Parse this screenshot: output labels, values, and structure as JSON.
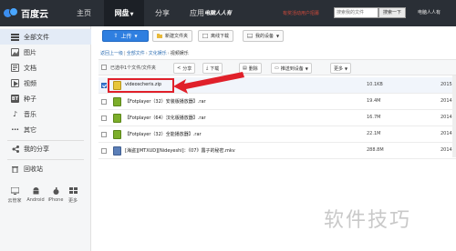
{
  "topnav": {
    "logo_text": "百度云",
    "items": [
      {
        "label": "主页"
      },
      {
        "label": "网盘"
      },
      {
        "label": "分享"
      },
      {
        "label": "应用"
      }
    ],
    "promo": "电脑人人有",
    "ad": "有奖活动用户招募",
    "search_placeholder": "搜索我的文件",
    "search_button": "搜索一下",
    "user": "电脑人人有"
  },
  "sidebar": {
    "items": [
      {
        "label": "全部文件"
      },
      {
        "label": "图片"
      },
      {
        "label": "文档"
      },
      {
        "label": "视频"
      },
      {
        "label": "种子"
      },
      {
        "label": "音乐"
      },
      {
        "label": "其它"
      },
      {
        "label": "我的分享"
      },
      {
        "label": "回收站"
      }
    ],
    "devices": [
      {
        "label": "云管家"
      },
      {
        "label": "Android"
      },
      {
        "label": "iPhone"
      },
      {
        "label": "更多"
      }
    ]
  },
  "toolbar": {
    "upload": "上传",
    "new_folder": "新建文件夹",
    "offline_download": "离线下载",
    "my_devices": "我的设备"
  },
  "breadcrumb": {
    "back": "返回上一级",
    "all_files": "全部文件",
    "culture": "文化娱乐",
    "current": "视频娱乐"
  },
  "actions": {
    "selection": "已选中1个文件/文件夹",
    "share": "分享",
    "download": "下载",
    "delete": "删除",
    "push": "推送到设备",
    "more": "更多"
  },
  "files": [
    {
      "name": "videoscheris.zip",
      "size": "10.1KB",
      "date": "2015",
      "type": "zip",
      "selected": true
    },
    {
      "name": "【Fotplayer（32）安装版播放器】.rar",
      "size": "19.4M",
      "date": "2014",
      "type": "rar",
      "selected": false
    },
    {
      "name": "【Fotplayer（64）汉化版播放器】.rar",
      "size": "16.7M",
      "date": "2014",
      "type": "rar",
      "selected": false
    },
    {
      "name": "【Fotplayer（32）全能播放器】.rar",
      "size": "22.1M",
      "date": "2014",
      "type": "rar",
      "selected": false
    },
    {
      "name": "[海盗][MTXUD][Nideyeshi]：《07》露子的秘密.mkv",
      "size": "288.8M",
      "date": "2014",
      "type": "mkv",
      "selected": false
    }
  ],
  "watermark": "软件技巧",
  "colors": {
    "nav_bg": "#2a2f36",
    "accent_blue": "#2f7fe0",
    "highlight_red": "#e0202a"
  }
}
